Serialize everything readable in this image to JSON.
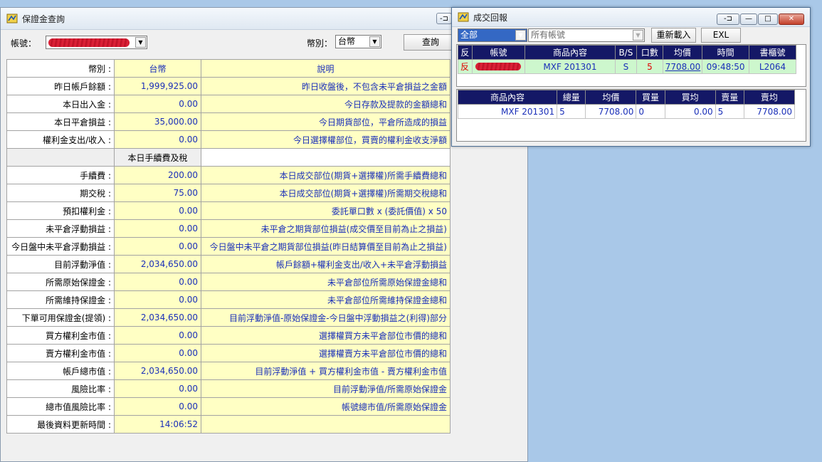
{
  "main": {
    "title": "保證金查詢",
    "account_label": "帳號：",
    "currency_label": "幣別：",
    "currency_value": "台幣",
    "query_button": "查詢",
    "header": {
      "label": "幣別 :",
      "currency": "台幣",
      "desc": "說明"
    },
    "rows": [
      {
        "label": "昨日帳戶餘額 :",
        "value": "1,999,925.00",
        "desc": "昨日收盤後，不包含未平倉損益之金額"
      },
      {
        "label": "本日出入金 :",
        "value": "0.00",
        "desc": "今日存款及提款的金額總和"
      },
      {
        "label": "本日平倉損益 :",
        "value": "35,000.00",
        "desc": "今日期貨部位，平倉所造成的損益"
      },
      {
        "label": "權利金支出/收入 :",
        "value": "0.00",
        "desc": "今日選擇權部位，買賣的權利金收支淨額"
      }
    ],
    "section_title": "本日手續費及稅",
    "rows2": [
      {
        "label": "手續費 :",
        "value": "200.00",
        "desc": "本日成交部位(期貨+選擇權)所需手續費總和"
      },
      {
        "label": "期交稅 :",
        "value": "75.00",
        "desc": "本日成交部位(期貨+選擇權)所需期交稅總和"
      },
      {
        "label": "預扣權利金 :",
        "value": "0.00",
        "desc": "委託單口數 x (委託價值) x 50"
      },
      {
        "label": "未平倉浮動損益 :",
        "value": "0.00",
        "desc": "未平倉之期貨部位損益(成交價至目前為止之損益)"
      },
      {
        "label": "今日盤中未平倉浮動損益 :",
        "value": "0.00",
        "desc": "今日盤中未平倉之期貨部位損益(昨日結算價至目前為止之損益)"
      },
      {
        "label": "目前浮動淨值 :",
        "value": "2,034,650.00",
        "desc": "帳戶餘額+權利金支出/收入+未平倉浮動損益"
      },
      {
        "label": "所需原始保證金 :",
        "value": "0.00",
        "desc": "未平倉部位所需原始保證金總和"
      },
      {
        "label": "所需維持保證金 :",
        "value": "0.00",
        "desc": "未平倉部位所需維持保證金總和"
      },
      {
        "label": "下單可用保證金(提領) :",
        "value": "2,034,650.00",
        "desc": "目前浮動淨值-原始保證金-今日盤中浮動損益之(利得)部分"
      },
      {
        "label": "買方權利金市值 :",
        "value": "0.00",
        "desc": "選擇權買方未平倉部位市價的總和"
      },
      {
        "label": "賣方權利金市值 :",
        "value": "0.00",
        "desc": "選擇權賣方未平倉部位市價的總和"
      },
      {
        "label": "帳戶總市值 :",
        "value": "2,034,650.00",
        "desc": "目前浮動淨值 + 買方權利金市值 - 賣方權利金市值"
      },
      {
        "label": "風險比率 :",
        "value": "0.00",
        "desc": "目前浮動淨值/所需原始保證金"
      },
      {
        "label": "總市值風險比率 :",
        "value": "0.00",
        "desc": "帳號總市值/所需原始保證金"
      },
      {
        "label": "最後資料更新時間 :",
        "value": "14:06:52",
        "desc": ""
      }
    ]
  },
  "report": {
    "title": "成交回報",
    "filter_value": "全部",
    "account_filter": "所有帳號",
    "reload_button": "重新載入",
    "exl_button": "EXL",
    "trades_headers": [
      "反",
      "帳號",
      "商品內容",
      "B/S",
      "口數",
      "均價",
      "時間",
      "書櫃號"
    ],
    "trades": [
      {
        "flag": "反",
        "product": "MXF 201301",
        "bs": "S",
        "qty": "5",
        "price": "7708.00",
        "time": "09:48:50",
        "book": "L2064"
      }
    ],
    "summary_headers": [
      "商品內容",
      "總量",
      "均價",
      "買量",
      "買均",
      "賣量",
      "賣均"
    ],
    "summary": [
      {
        "product": "MXF 201301",
        "total": "5",
        "avg": "7708.00",
        "buy_qty": "0",
        "buy_avg": "0.00",
        "sell_qty": "5",
        "sell_avg": "7708.00"
      }
    ]
  },
  "colors": {
    "desktop": "#a9c8e8",
    "grid_header": "#141866",
    "cell_yellow": "#ffffc4",
    "value_blue": "#1a2fb8"
  }
}
